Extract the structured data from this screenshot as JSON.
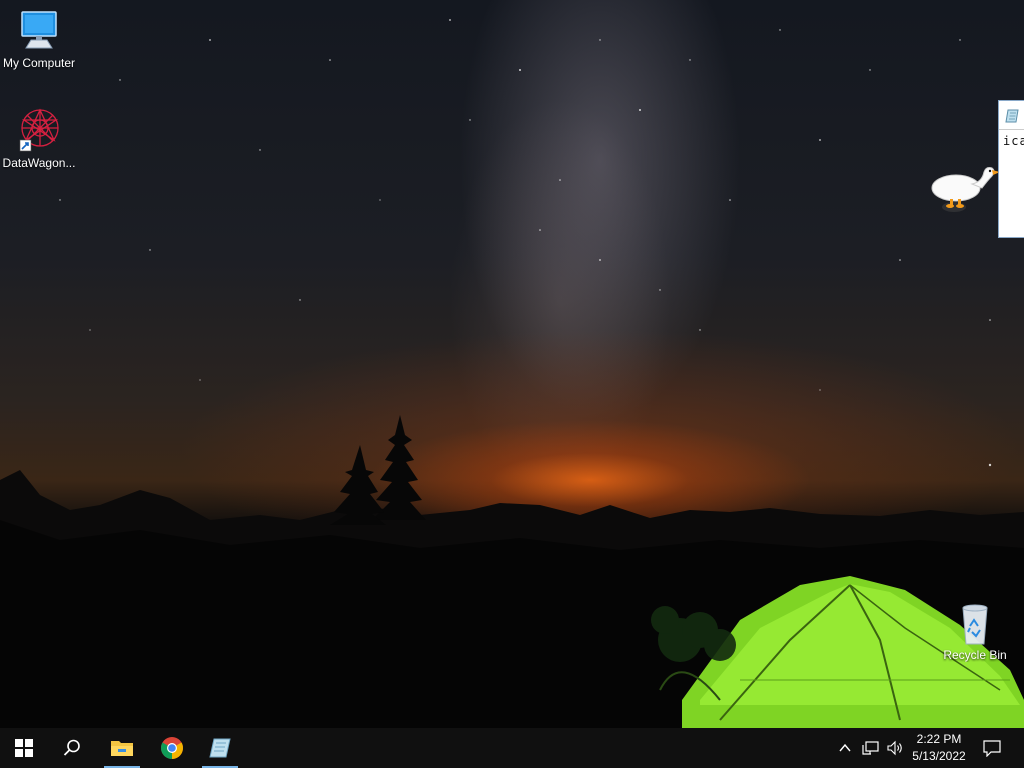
{
  "desktop": {
    "icons": [
      {
        "label": "My Computer",
        "icon": "computer-icon"
      },
      {
        "label": "DataWagon...",
        "icon": "datawagon-shortcut-icon"
      },
      {
        "label": "Recycle Bin",
        "icon": "recycle-bin-icon"
      }
    ],
    "partial_window": {
      "text": "ica",
      "icon": "notepad-app-icon"
    },
    "mascot": "goose-icon"
  },
  "taskbar": {
    "pinned": [
      {
        "name": "start",
        "icon": "windows-logo-icon"
      },
      {
        "name": "search",
        "icon": "search-icon"
      },
      {
        "name": "file-explorer",
        "icon": "folder-icon",
        "active": true
      },
      {
        "name": "chrome",
        "icon": "chrome-icon",
        "active": false
      },
      {
        "name": "notepad",
        "icon": "notepad-icon",
        "active": true
      }
    ],
    "tray": {
      "icons": [
        "chevron-up-icon",
        "network-icon",
        "volume-icon",
        "notification-icon"
      ],
      "time": "2:22 PM",
      "date": "5/13/2022"
    }
  },
  "colors": {
    "taskbar": "#101010",
    "active_indicator": "#78b4e6",
    "tent_green": "#8ee62a",
    "horizon_glow": "#ff6a14"
  }
}
